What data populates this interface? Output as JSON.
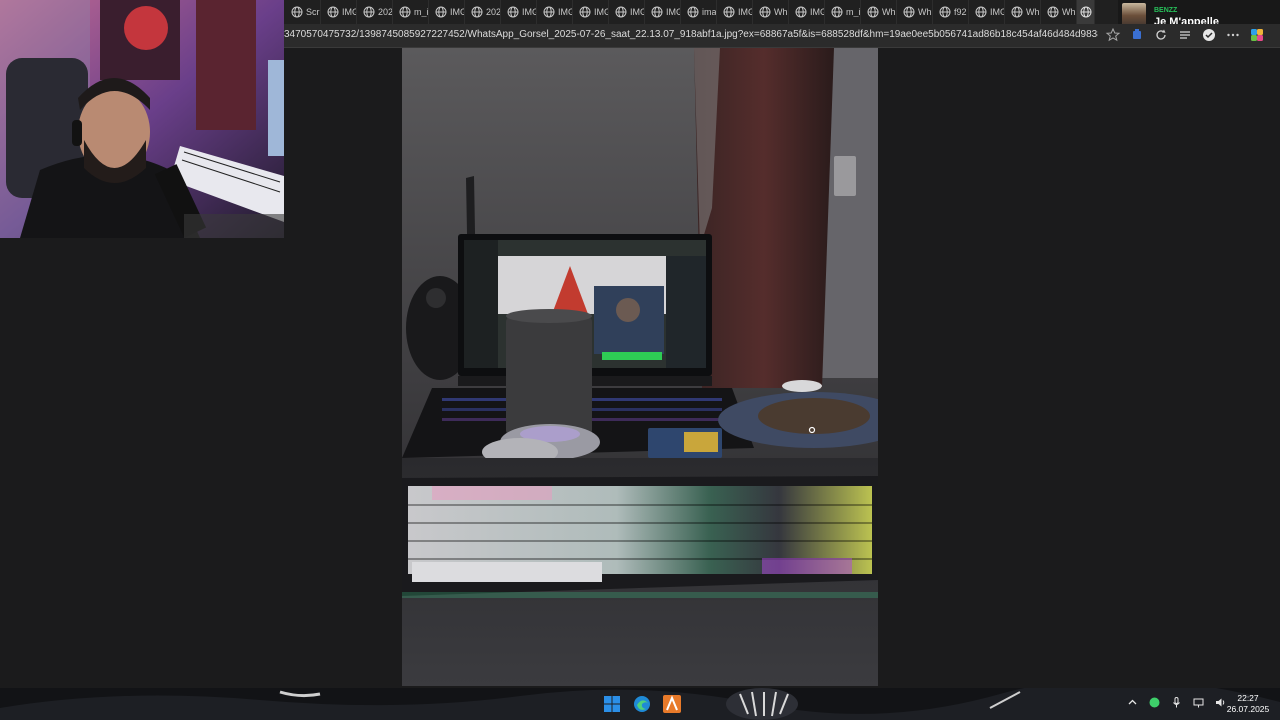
{
  "browser": {
    "tabs": [
      "Scr",
      "IMG",
      "202",
      "m_i",
      "IMG",
      "202",
      "IMG",
      "IMG",
      "IMG",
      "IMG",
      "IMG",
      "ima",
      "IMG",
      "Wh",
      "IMG",
      "m_i",
      "Wh",
      "Wh",
      "f92",
      "IMG",
      "Wh",
      "Wh"
    ],
    "url": "3470570475732/1398745085927227452/WhatsApp_Gorsel_2025-07-26_saat_22.13.07_918abf1a.jpg?ex=68867a5f&is=688528df&hm=19ae0ee5b056741ad86b18c454af46d484d98388bd11016d1c7...",
    "toolbar_icons": [
      "star-icon",
      "extension-icon",
      "refresh-icon",
      "collections-icon",
      "shield-icon",
      "more-icon",
      "copilot-icon"
    ]
  },
  "now_playing": {
    "artist": "BENZZ",
    "title": "Je M'appelle"
  },
  "taskbar": {
    "apps": [
      "windows-start-icon",
      "edge-icon",
      "app-icon"
    ],
    "tray_icons": [
      "chevron-up-icon",
      "status-dot-icon",
      "microphone-icon",
      "network-icon",
      "volume-icon"
    ],
    "time": "22:27",
    "date": "26.07.2025"
  },
  "colors": {
    "spotify_green": "#27c05a",
    "viewer_bg": "#1b1b1c"
  }
}
